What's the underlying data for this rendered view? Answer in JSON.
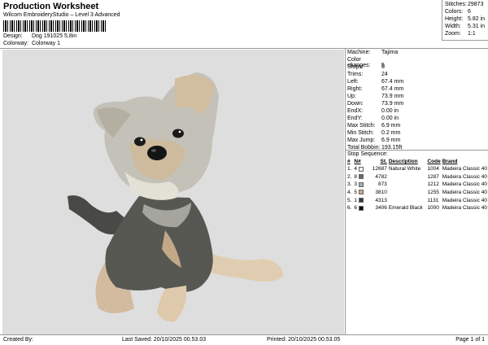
{
  "header": {
    "title": "Production Worksheet",
    "subtitle": "Wilcom EmbroideryStudio – Level 3 Advanced",
    "design_label": "Design:",
    "design_value": "Dog 191025 5,8in",
    "colorway_label": "Colorway:",
    "colorway_value": "Colorway 1"
  },
  "stats": [
    {
      "k": "Stitches:",
      "v": "29873"
    },
    {
      "k": "Colors:",
      "v": "6"
    },
    {
      "k": "Height:",
      "v": "5.82 in"
    },
    {
      "k": "Width:",
      "v": "5.31 in"
    },
    {
      "k": "Zoom:",
      "v": "1:1"
    }
  ],
  "properties": [
    {
      "k": "Machine:",
      "v": "Tajima"
    },
    {
      "k": "Color changes:",
      "v": "5"
    },
    {
      "k": "Stops:",
      "v": "6"
    },
    {
      "k": "Trims:",
      "v": "24"
    },
    {
      "k": "Left:",
      "v": "67.4 mm"
    },
    {
      "k": "Right:",
      "v": "67.4 mm"
    },
    {
      "k": "Up:",
      "v": "73.9 mm"
    },
    {
      "k": "Down:",
      "v": "73.9 mm"
    },
    {
      "k": "EndX:",
      "v": "0.00 in"
    },
    {
      "k": "EndY:",
      "v": "0.00 in"
    },
    {
      "k": "Max Stitch:",
      "v": "6.9 mm"
    },
    {
      "k": "Min Stitch:",
      "v": "0.2 mm"
    },
    {
      "k": "Max Jump:",
      "v": "6.9 mm"
    },
    {
      "k": "Total Bobbin:",
      "v": "193.15ft"
    }
  ],
  "stop_sequence": {
    "title": "Stop Sequence:",
    "headers": [
      "#",
      "N#",
      "St.",
      "Description",
      "Code",
      "Brand"
    ],
    "rows": [
      {
        "n": "1.",
        "num": "4",
        "color": "#f4f4ee",
        "st": "12687",
        "desc": "Natural White",
        "code": "1004",
        "brand": "Madeira Classic 40"
      },
      {
        "n": "2.",
        "num": "8",
        "color": "#6b6b66",
        "st": "4782",
        "desc": "",
        "code": "1287",
        "brand": "Madeira Classic 40"
      },
      {
        "n": "3.",
        "num": "3",
        "color": "#a9aca8",
        "st": "873",
        "desc": "",
        "code": "1212",
        "brand": "Madeira Classic 40"
      },
      {
        "n": "4.",
        "num": "5",
        "color": "#c9a98b",
        "st": "3810",
        "desc": "",
        "code": "1255",
        "brand": "Madeira Classic 40"
      },
      {
        "n": "5.",
        "num": "1",
        "color": "#3a3a37",
        "st": "4313",
        "desc": "",
        "code": "1131",
        "brand": "Madeira Classic 40"
      },
      {
        "n": "6.",
        "num": "6",
        "color": "#111111",
        "st": "3406",
        "desc": "Emerald Black",
        "code": "1000",
        "brand": "Madeira Classic 40"
      }
    ]
  },
  "footer": {
    "created_by": "Created By:",
    "last_saved": "Last Saved: 20/10/2025 00.53.03",
    "printed": "Printed: 20/10/2025 00.53.05",
    "page": "Page 1 of 1"
  }
}
